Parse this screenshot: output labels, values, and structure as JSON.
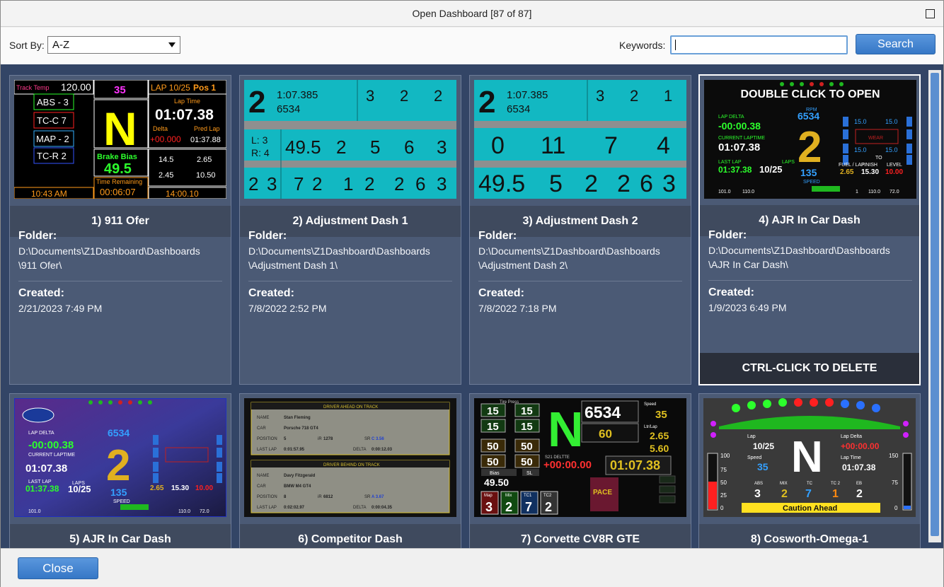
{
  "window": {
    "title": "Open Dashboard [87 of 87]"
  },
  "toolbar": {
    "sort_label": "Sort By:",
    "sort_value": "A-Z",
    "keywords_label": "Keywords:",
    "keywords_value": "",
    "search_label": "Search"
  },
  "hover": {
    "open_hint": "DOUBLE CLICK TO OPEN",
    "delete_hint": "CTRL-CLICK TO DELETE"
  },
  "labels": {
    "folder": "Folder:",
    "created": "Created:"
  },
  "cards": [
    {
      "name": "1) 911 Ofer",
      "folder_line1": "D:\\Documents\\Z1Dashboard\\Dashboards",
      "folder_line2": "\\911 Ofer\\",
      "created": "2/21/2023 7:49 PM"
    },
    {
      "name": "2) Adjustment Dash 1",
      "folder_line1": "D:\\Documents\\Z1Dashboard\\Dashboards",
      "folder_line2": "\\Adjustment Dash 1\\",
      "created": "7/8/2022 2:52 PM"
    },
    {
      "name": "3) Adjustment Dash 2",
      "folder_line1": "D:\\Documents\\Z1Dashboard\\Dashboards",
      "folder_line2": "\\Adjustment Dash 2\\",
      "created": "7/8/2022 7:18 PM"
    },
    {
      "name": "4) AJR In Car Dash",
      "folder_line1": "D:\\Documents\\Z1Dashboard\\Dashboards",
      "folder_line2": "\\AJR In Car Dash\\",
      "created": "1/9/2023 6:49 PM"
    },
    {
      "name": "5) AJR In Car Dash"
    },
    {
      "name": "6) Competitor Dash"
    },
    {
      "name": "7) Corvette CV8R GTE"
    },
    {
      "name": "8) Cosworth-Omega-1"
    }
  ],
  "thumb911": {
    "track_temp_label": "Track Temp",
    "track_temp": "120.00",
    "speed": "35",
    "lap": "LAP 10/25",
    "pos": "Pos 1",
    "abs": "ABS - 3",
    "tcc": "TC-C 7",
    "map": "MAP - 2",
    "tcr": "TC-R 2",
    "gear": "N",
    "lap_time_label": "Lap Time",
    "lap_time": "01:07.38",
    "delta_label": "Delta",
    "delta": "+00.000",
    "pred_label": "Pred Lap",
    "pred": "01:37.88",
    "brake_bias_label": "Brake Bias",
    "brake_bias": "49.5",
    "rem_laps": "14.5",
    "avg_lap": "2.65",
    "last_lap": "2.45",
    "to_add": "10.50",
    "time_rem_label": "Time Remaining",
    "time_rem": "00:06:07",
    "clock": "10:43 AM",
    "clock2": "14:00.10"
  },
  "thumbAdj1": {
    "gear": "2",
    "laptime": "1:07.385",
    "rpm": "6534",
    "power": "3",
    "braking": "2",
    "shaping": "2",
    "l": "L: 3",
    "r": "R: 4",
    "bias": "49.5",
    "fuel_mix": "2",
    "boost": "5",
    "rev": "6",
    "abs": "3",
    "arb_f": "2",
    "arb_r": "3",
    "tc_one": "7",
    "tc_two": "2",
    "wing_f": "1",
    "wing_r": "2",
    "diff_e": "2",
    "diff_m": "6",
    "diff_x": "3"
  },
  "thumbAdj2": {
    "gear": "2",
    "laptime": "1:07.385",
    "rpm": "6534",
    "power": "3",
    "braking": "2",
    "shaping": "1",
    "regen": "0",
    "deploy_fixed": "11",
    "deploy_adapt": "7",
    "preload": "4",
    "brake_bias": "49.5",
    "peak_bias": "5",
    "fuel_mix": "2",
    "diff_entry": "2",
    "diff_middle": "6",
    "diff_exit": "3"
  },
  "thumbAJR": {
    "rpm_label": "RPM",
    "rpm": "6534",
    "delta_label": "LAP DELTA",
    "delta": "-00:00.38",
    "cur_label": "CURRENT LAPTIME",
    "cur": "01:07.38",
    "last_label": "LAST LAP",
    "last": "01:37.38",
    "laps_label": "LAPS",
    "laps": "10/25",
    "gear": "2",
    "speed": "135",
    "speed_label": "SPEED",
    "fuel_label": "FUEL / LAP",
    "fuel": "2.65",
    "finish_label": "FINISH",
    "finish": "15.30",
    "level_label": "LEVEL",
    "level": "10.00",
    "to_label": "TO",
    "wear_label": "WEAR",
    "tyre": "15.0",
    "oil": "101.0",
    "water": "110.0",
    "air": "72.0",
    "pos": "1"
  },
  "thumbComp": {
    "ahead_title": "DRIVER AHEAD ON TRACK",
    "behind_title": "DRIVER BEHIND ON TRACK",
    "name_label": "NAME",
    "car_label": "CAR",
    "pos_label": "POSITION",
    "ir_label": "iR",
    "sr_label": "SR",
    "lastlap_label": "LAST LAP",
    "delta_label": "DELTA",
    "ahead_name": "Stan Fleming",
    "ahead_car": "Porsche 718 GT4",
    "ahead_pos": "5",
    "ahead_ir": "1278",
    "ahead_sr": "C 3.56",
    "ahead_last": "0:01:57.95",
    "ahead_delta": "0:00:12.03",
    "behind_name": "Davy Fitzgerald",
    "behind_car": "BMW M4 GT4",
    "behind_pos": "8",
    "behind_ir": "6812",
    "behind_sr": "A 3.67",
    "behind_last": "0:02:02.97",
    "behind_delta": "0:00:04.35"
  },
  "thumbCorv": {
    "tire_label": "Tire Press",
    "tire": "15",
    "temp": "50",
    "bias_label": "Bias",
    "bias": "49.50",
    "sl_label": "SL",
    "gear": "N",
    "rpm": "6534",
    "gap": "60",
    "speed_label": "Speed",
    "speed": "35",
    "ltr_label": "Ltr/Lap",
    "ltr": "2.65",
    "fuel": "5.60",
    "delta_label": "S21 DELTTE",
    "delta": "+00:00.00",
    "laptime": "01:07.38",
    "pace": "PACE",
    "map_label": "Map",
    "map": "3",
    "mix_label": "Mix",
    "mix": "2",
    "tc1_label": "TC1",
    "tc1": "7",
    "tc2_label": "TC2",
    "tc2": "2"
  },
  "thumbCos": {
    "lap_label": "Lap",
    "lap": "10/25",
    "speed_label": "Speed",
    "speed": "35",
    "gear": "N",
    "delta_label": "Lap Delta",
    "delta": "+00:00.00",
    "laptime_label": "Lap Time",
    "laptime": "01:07.38",
    "abs_label": "ABS",
    "abs": "3",
    "mix_label": "MIX",
    "mix": "2",
    "tc_label": "TC",
    "tc": "7",
    "tc2_label": "TC 2",
    "tc2": "1",
    "eb_label": "EB",
    "eb": "2",
    "caution": "Caution Ahead",
    "scale_l": [
      "100",
      "75",
      "50",
      "25",
      "0"
    ],
    "scale_r": [
      "150",
      "75",
      "0"
    ]
  },
  "colors": {
    "content_bg": "#334566",
    "card_bg": "#4b5a75",
    "accent": "#3677c6"
  }
}
